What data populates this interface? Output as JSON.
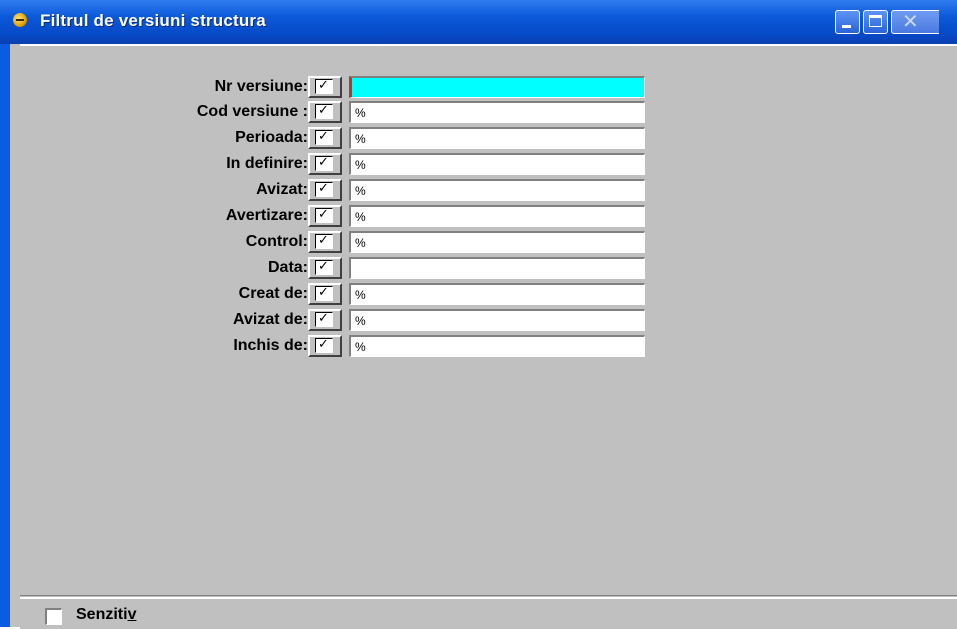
{
  "window": {
    "title": "Filtrul de versiuni structura"
  },
  "colors": {
    "title_bar": "#0a58d8",
    "background": "#c0c0c0",
    "active_field": "#00ffff"
  },
  "fields": [
    {
      "label": "Nr versiune:",
      "checked": true,
      "value": ""
    },
    {
      "label": "Cod versiune :",
      "checked": true,
      "value": "%"
    },
    {
      "label": "Perioada:",
      "checked": true,
      "value": "%"
    },
    {
      "label": "In definire:",
      "checked": true,
      "value": "%"
    },
    {
      "label": "Avizat:",
      "checked": true,
      "value": "%"
    },
    {
      "label": "Avertizare:",
      "checked": true,
      "value": "%"
    },
    {
      "label": "Control:",
      "checked": true,
      "value": "%"
    },
    {
      "label": "Data:",
      "checked": true,
      "value": ""
    },
    {
      "label": "Creat de:",
      "checked": true,
      "value": "%"
    },
    {
      "label": "Avizat de:",
      "checked": true,
      "value": "%"
    },
    {
      "label": "Inchis de:",
      "checked": true,
      "value": "%"
    }
  ],
  "footer": {
    "senzitiv_main": "Senziti",
    "senzitiv_accel": "v",
    "senzitiv_checked": false
  },
  "icons": {
    "app": "app-icon",
    "minimize": "minimize-icon",
    "maximize": "maximize-icon",
    "close": "close-icon",
    "check": "check-icon"
  }
}
